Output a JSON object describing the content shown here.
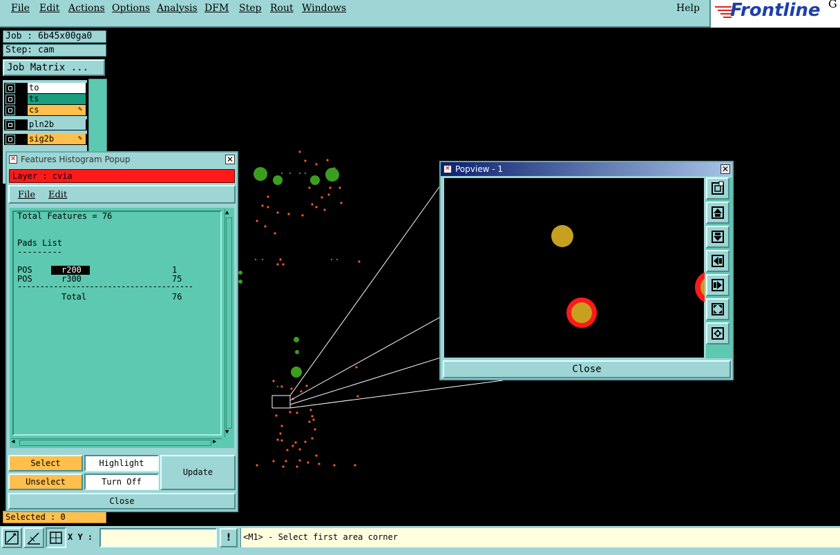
{
  "menubar": {
    "items": [
      "File",
      "Edit",
      "Actions",
      "Options",
      "Analysis",
      "DFM",
      "Step",
      "Rout",
      "Windows"
    ],
    "help": "Help",
    "logo": "Frontline",
    "logo_suffix": "G"
  },
  "left_panel": {
    "job": "Job : 6b45x00ga0",
    "step": "Step: cam",
    "job_matrix": "Job Matrix ...",
    "layers": [
      {
        "name": "to",
        "color": "#ffffff",
        "edit": false
      },
      {
        "name": "ts",
        "color": "#1a9e7e",
        "edit": false
      },
      {
        "name": "cs",
        "color": "#ffbf4d",
        "edit": true
      },
      {
        "name": "pln2b",
        "color": "#9ed6d6",
        "edit": false
      },
      {
        "name": "sig2b",
        "color": "#ffbf4d",
        "edit": true
      }
    ],
    "selected": "Selected : 0"
  },
  "features_popup": {
    "title": "Features Histogram Popup",
    "layer_label": "Layer :  cvia",
    "menu": [
      "File",
      "Edit"
    ],
    "text": {
      "total": "Total Features = 76",
      "pads_list": "Pads List",
      "pads_underline": "---------",
      "rows": [
        {
          "pol": "POS",
          "sym": "r200",
          "count": "1",
          "highlighted": true
        },
        {
          "pol": "POS",
          "sym": "r300",
          "count": "75",
          "highlighted": false
        }
      ],
      "separator": "---------------------------------------",
      "total_label": "Total",
      "total_count": "76"
    },
    "buttons": {
      "select": "Select",
      "highlight": "Highlight",
      "unselect": "Unselect",
      "turn_off": "Turn Off",
      "update": "Update",
      "close": "Close"
    }
  },
  "popview": {
    "title": "Popview - 1",
    "close": "Close",
    "tools": [
      "zoom-in-icon",
      "zoom-up-icon",
      "zoom-down-icon",
      "zoom-left-icon",
      "zoom-right-icon",
      "fit-icon",
      "center-icon"
    ]
  },
  "bottom": {
    "xy_label": "X Y :",
    "xy_value": "",
    "warn": "!",
    "status": "<M1> - Select first area corner"
  },
  "colors": {
    "panel": "#9ed6d6",
    "dialog_fill": "#5cc9b0",
    "layer_bar": "#ff0000",
    "pad_gold": "#c8a020",
    "pad_ring": "#ff1a1a",
    "green_pad": "#3c9e1e",
    "orange_dot": "#ff5a28"
  }
}
